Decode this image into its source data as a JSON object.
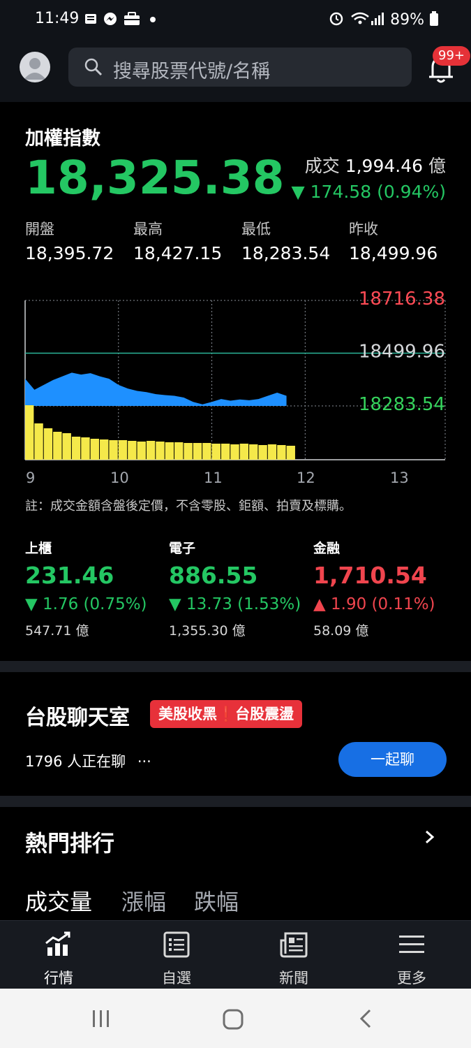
{
  "status_bar": {
    "time": "11:49",
    "battery": "89%"
  },
  "search": {
    "placeholder": "搜尋股票代號/名稱"
  },
  "notifications": {
    "badge": "99+"
  },
  "index": {
    "title": "加權指數",
    "price": "18,325.38",
    "volume_label": "成交",
    "volume_value": "1,994.46",
    "volume_unit": "億",
    "change": "▼ 174.58 (0.94%)",
    "ohlc": [
      {
        "label": "開盤",
        "value": "18,395.72"
      },
      {
        "label": "最高",
        "value": "18,427.15"
      },
      {
        "label": "最低",
        "value": "18,283.54"
      },
      {
        "label": "昨收",
        "value": "18,499.96"
      }
    ]
  },
  "chart_data": {
    "type": "area",
    "y_tick_labels": [
      "18716.38",
      "18499.96",
      "18283.54"
    ],
    "y_tick_values": [
      18716.38,
      18499.96,
      18283.54
    ],
    "ylim": [
      18283.54,
      18716.38
    ],
    "reference_line": 18499.96,
    "x_tick_labels": [
      "9",
      "10",
      "11",
      "12",
      "13"
    ],
    "xlim": [
      9,
      13.5
    ],
    "x": [
      9.0,
      9.1,
      9.2,
      9.3,
      9.4,
      9.5,
      9.6,
      9.7,
      9.8,
      9.9,
      10.0,
      10.1,
      10.2,
      10.3,
      10.4,
      10.5,
      10.6,
      10.7,
      10.8,
      10.9,
      11.0,
      11.1,
      11.2,
      11.3,
      11.4,
      11.5,
      11.6,
      11.7,
      11.8
    ],
    "values": [
      18395,
      18350,
      18370,
      18390,
      18405,
      18420,
      18412,
      18418,
      18405,
      18395,
      18370,
      18355,
      18345,
      18340,
      18332,
      18328,
      18325,
      18318,
      18300,
      18290,
      18300,
      18312,
      18305,
      18310,
      18307,
      18312,
      18325,
      18338,
      18325
    ],
    "volume": [
      78,
      52,
      45,
      40,
      38,
      33,
      32,
      30,
      29,
      28,
      28,
      27,
      26,
      27,
      26,
      25,
      25,
      24,
      24,
      24,
      23,
      23,
      22,
      23,
      22,
      21,
      22,
      21,
      20
    ],
    "series": [
      {
        "values_ref": "values",
        "color": "#1e90ff"
      },
      {
        "values_ref": "volume",
        "color": "#ffeb3b"
      }
    ]
  },
  "chart_note": "註：成交金額含盤後定價，不含零股、鉅額、拍賣及標購。",
  "markets": [
    {
      "title": "上櫃",
      "value": "231.46",
      "change": "▼ 1.76 (0.75%)",
      "amount": "547.71 億",
      "color": "#24c763"
    },
    {
      "title": "電子",
      "value": "886.55",
      "change": "▼ 13.73 (1.53%)",
      "amount": "1,355.30 億",
      "color": "#24c763"
    },
    {
      "title": "金融",
      "value": "1,710.54",
      "change": "▲ 1.90 (0.11%)",
      "amount": "58.09 億",
      "color": "#f0454e"
    }
  ],
  "chatroom": {
    "title": "台股聊天室",
    "tag": "美股收黑❗台股震盪",
    "online": "1796 人正在聊",
    "more": "···",
    "join_label": "一起聊"
  },
  "ranking": {
    "title": "熱門排行",
    "tabs": [
      "成交量",
      "漲幅",
      "跌幅"
    ]
  },
  "bottom_nav": [
    {
      "label": "行情",
      "icon": "chart-icon"
    },
    {
      "label": "自選",
      "icon": "list-icon"
    },
    {
      "label": "新聞",
      "icon": "news-icon"
    },
    {
      "label": "更多",
      "icon": "menu-icon"
    }
  ]
}
